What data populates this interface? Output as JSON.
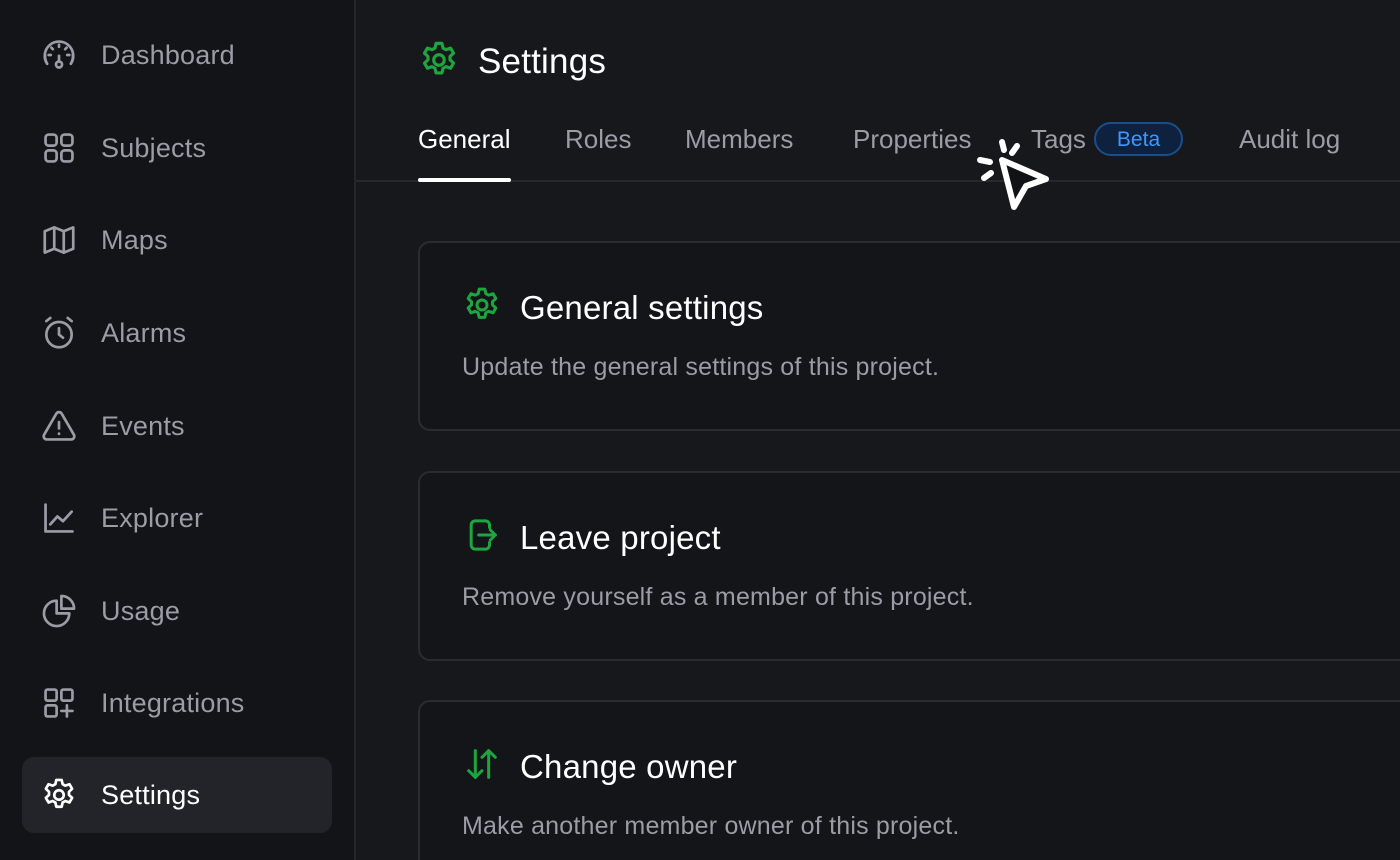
{
  "sidebar": {
    "items": [
      {
        "label": "Dashboard",
        "icon": "dashboard-gauge-icon",
        "active": false
      },
      {
        "label": "Subjects",
        "icon": "grid-squares-icon",
        "active": false
      },
      {
        "label": "Maps",
        "icon": "map-icon",
        "active": false
      },
      {
        "label": "Alarms",
        "icon": "alarm-clock-icon",
        "active": false
      },
      {
        "label": "Events",
        "icon": "warning-triangle-icon",
        "active": false
      },
      {
        "label": "Explorer",
        "icon": "line-chart-icon",
        "active": false
      },
      {
        "label": "Usage",
        "icon": "pie-chart-icon",
        "active": false
      },
      {
        "label": "Integrations",
        "icon": "add-apps-icon",
        "active": false
      },
      {
        "label": "Settings",
        "icon": "gear-icon",
        "active": true
      }
    ]
  },
  "header": {
    "title": "Settings",
    "icon": "gear-icon"
  },
  "tabs": {
    "items": [
      {
        "label": "General",
        "active": true
      },
      {
        "label": "Roles",
        "active": false
      },
      {
        "label": "Members",
        "active": false
      },
      {
        "label": "Properties",
        "active": false
      },
      {
        "label": "Tags",
        "active": false,
        "badge": "Beta"
      },
      {
        "label": "Audit log",
        "active": false
      }
    ]
  },
  "cards": [
    {
      "title": "General settings",
      "description": "Update the general settings of this project.",
      "icon": "gear-icon"
    },
    {
      "title": "Leave project",
      "description": "Remove yourself as a member of this project.",
      "icon": "exit-door-icon"
    },
    {
      "title": "Change owner",
      "description": "Make another member owner of this project.",
      "icon": "swap-arrows-icon"
    }
  ],
  "colors": {
    "background": "#17181c",
    "sidebar_background": "#131418",
    "accent_green": "#1fa53f",
    "badge_blue": "#3d97ff",
    "muted_text": "#9a9ca6"
  }
}
